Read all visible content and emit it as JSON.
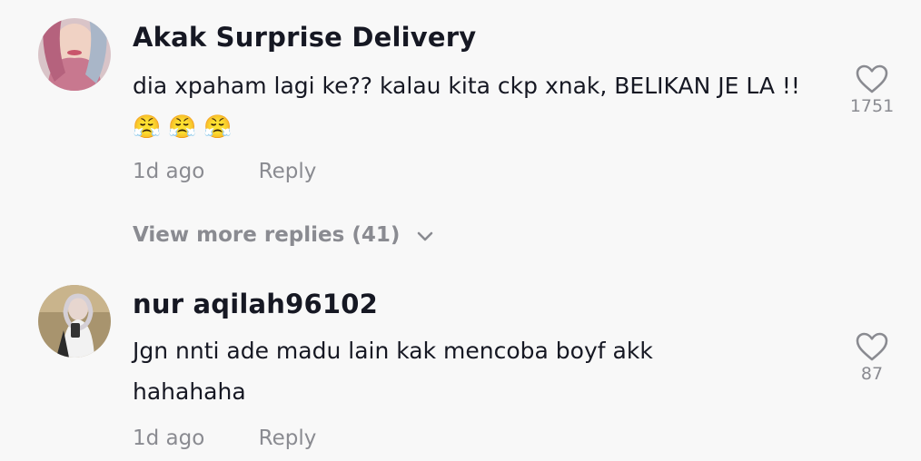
{
  "comments": [
    {
      "username": "Akak Surprise Delivery",
      "text": "dia xpaham lagi ke?? kalau kita ckp xnak, BELIKAN JE LA !! 😤 😤 😤",
      "time": "1d ago",
      "reply_label": "Reply",
      "likes": "1751",
      "avatar_icon": "avatar-photo-hijab-pink",
      "like_icon": "heart-outline-icon"
    },
    {
      "username": "nur aqilah96102",
      "text": "Jgn nnti ade madu lain kak mencoba boyf akk hahahaha",
      "time": "1d ago",
      "reply_label": "Reply",
      "likes": "87",
      "avatar_icon": "avatar-photo-mirror-selfie",
      "like_icon": "heart-outline-icon"
    }
  ],
  "view_more": {
    "label": "View more replies (41)",
    "icon": "chevron-down-icon"
  },
  "colors": {
    "background": "#f8f8f8",
    "primary_text": "#161823",
    "secondary_text": "#8a8b91"
  }
}
